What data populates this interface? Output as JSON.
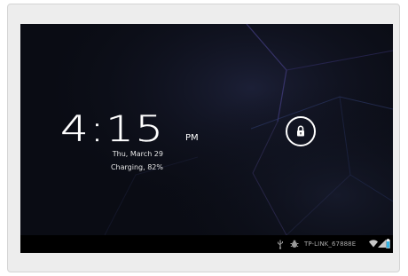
{
  "lockscreen": {
    "time": "4:15",
    "ampm": "PM",
    "date": "Thu, March 29",
    "charging": "Charging, 82%"
  },
  "status_bar": {
    "network_name": "TP-LINK_67888E",
    "icons": [
      "usb-icon",
      "debug-icon",
      "wifi-icon",
      "signal-icon",
      "battery-icon"
    ]
  },
  "colors": {
    "screen_background": "#0a0c14",
    "status_bar": "#000000",
    "lock_ring": "#ffffff",
    "battery_accent": "#33b5e5"
  }
}
